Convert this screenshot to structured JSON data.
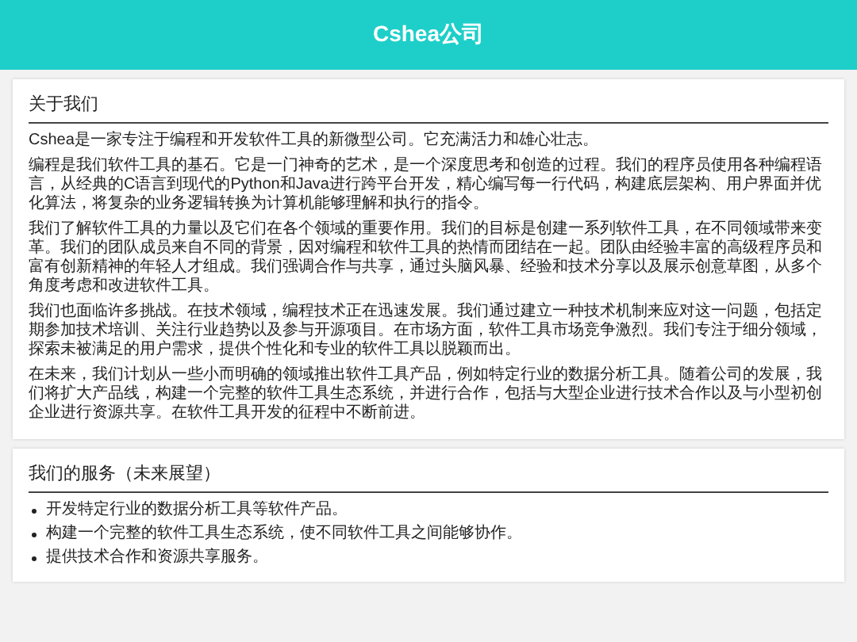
{
  "header": {
    "title": "Cshea公司"
  },
  "sections": [
    {
      "title": "关于我们",
      "kind": "paragraphs",
      "items": [
        "Cshea是一家专注于编程和开发软件工具的新微型公司。它充满活力和雄心壮志。",
        "编程是我们软件工具的基石。它是一门神奇的艺术，是一个深度思考和创造的过程。我们的程序员使用各种编程语言，从经典的C语言到现代的Python和Java进行跨平台开发，精心编写每一行代码，构建底层架构、用户界面并优化算法，将复杂的业务逻辑转换为计算机能够理解和执行的指令。",
        "我们了解软件工具的力量以及它们在各个领域的重要作用。我们的目标是创建一系列软件工具，在不同领域带来变革。我们的团队成员来自不同的背景，因对编程和软件工具的热情而团结在一起。团队由经验丰富的高级程序员和富有创新精神的年轻人才组成。我们强调合作与共享，通过头脑风暴、经验和技术分享以及展示创意草图，从多个角度考虑和改进软件工具。",
        "我们也面临许多挑战。在技术领域，编程技术正在迅速发展。我们通过建立一种技术机制来应对这一问题，包括定期参加技术培训、关注行业趋势以及参与开源项目。在市场方面，软件工具市场竞争激烈。我们专注于细分领域，探索未被满足的用户需求，提供个性化和专业的软件工具以脱颖而出。",
        "在未来，我们计划从一些小而明确的领域推出软件工具产品，例如特定行业的数据分析工具。随着公司的发展，我们将扩大产品线，构建一个完整的软件工具生态系统，并进行合作，包括与大型企业进行技术合作以及与小型初创企业进行资源共享。在软件工具开发的征程中不断前进。"
      ]
    },
    {
      "title": "我们的服务（未来展望）",
      "kind": "bullets",
      "items": [
        "开发特定行业的数据分析工具等软件产品。",
        "构建一个完整的软件工具生态系统，使不同软件工具之间能够协作。",
        "提供技术合作和资源共享服务。"
      ]
    }
  ]
}
